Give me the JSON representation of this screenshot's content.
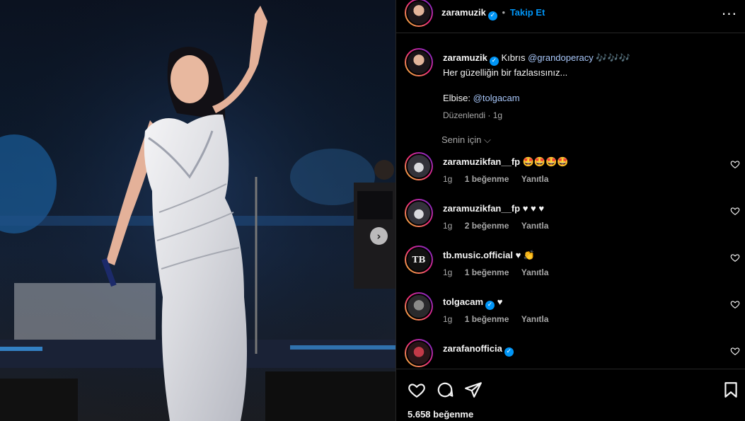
{
  "post": {
    "username": "zaramuzik",
    "follow_label": "Takip Et",
    "more_icon": "more-horizontal-icon",
    "caption_location": "Kıbrıs",
    "caption_mention": "@grandoperacy",
    "caption_music": "🎶🎶🎶",
    "caption_line2": "Her güzelliğin bir fazlasısınız...",
    "caption_dress_label": "Elbise:",
    "caption_dress_mention": "@tolgacam",
    "edited_label": "Düzenlendi",
    "edited_time": "1g",
    "for_you_label": "Senin için ⌵",
    "likes": "5.658 beğenme"
  },
  "comments": [
    {
      "user": "zaramuzikfan__fp",
      "text": "🤩🤩🤩🤩",
      "time": "1g",
      "likes": "1 beğenme",
      "reply": "Yanıtla",
      "verified": false
    },
    {
      "user": "zaramuzikfan__fp",
      "text": "♥ ♥ ♥",
      "time": "1g",
      "likes": "2 beğenme",
      "reply": "Yanıtla",
      "verified": false
    },
    {
      "user": "tb.music.official",
      "text": "♥ 👏",
      "time": "1g",
      "likes": "1 beğenme",
      "reply": "Yanıtla",
      "verified": false
    },
    {
      "user": "tolgacam",
      "text": "♥",
      "time": "1g",
      "likes": "1 beğenme",
      "reply": "Yanıtla",
      "verified": true
    },
    {
      "user": "zarafanofficia",
      "text": "",
      "time": "",
      "likes": "",
      "reply": "",
      "verified": true
    }
  ],
  "avatars": {
    "tb_text": "TB"
  },
  "colors": {
    "background": "#000000",
    "accent": "#0095f6",
    "muted": "#a8a8a8"
  }
}
